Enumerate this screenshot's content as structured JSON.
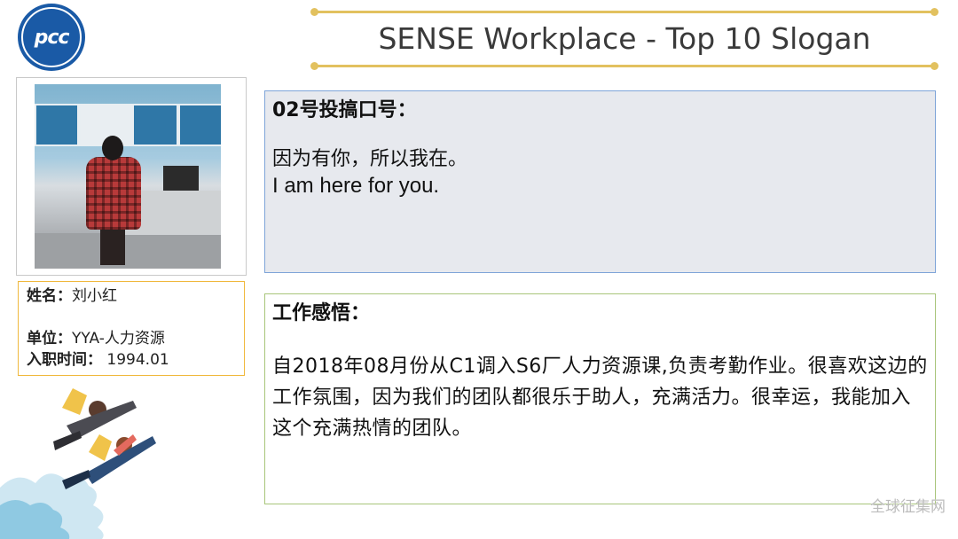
{
  "header": {
    "logo_text": "pcc",
    "title": "SENSE Workplace - Top 10 Slogan"
  },
  "profile": {
    "name_label": "姓名：",
    "name_value": "刘小红",
    "unit_label": "单位：",
    "unit_value": "YYA-人力资源",
    "hire_label": "入职时间：",
    "hire_value": " 1994.01"
  },
  "slogan": {
    "heading": "02号投搞口号：",
    "text_cn": "因为有你，所以我在。",
    "text_en": "I am here for you."
  },
  "reflection": {
    "heading": "工作感悟：",
    "body": "自2018年08月份从C1调入S6厂人力资源课,负责考勤作业。很喜欢这边的工作氛围，因为我们的团队都很乐于助人，充满活力。很幸运，我能加入这个充满热情的团队。"
  },
  "watermark": "全球征集网",
  "colors": {
    "logo_blue": "#1a5aa6",
    "title_line_gold": "#e2c15f",
    "slogan_border": "#7ea4d8",
    "slogan_bg": "#e7e9ee",
    "reflection_border": "#a8c57a",
    "info_border": "#f0b83c"
  }
}
